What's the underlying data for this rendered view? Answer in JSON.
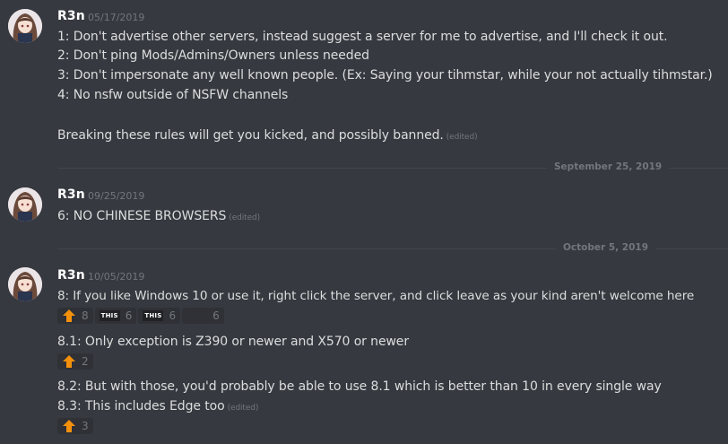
{
  "messages": [
    {
      "author": "R3n",
      "timestamp": "05/17/2019",
      "lines": [
        "1: Don't advertise other servers, instead suggest a server for me to advertise, and I'll check it out.",
        "2: Don't ping Mods/Admins/Owners unless needed",
        "3: Don't impersonate any well known people. (Ex: Saying your tihmstar, while your not actually tihmstar.)",
        "4: No nsfw outside of NSFW channels",
        "Breaking these rules will get you kicked, and possibly banned."
      ],
      "edited_label": "(edited)"
    },
    {
      "author": "R3n",
      "timestamp": "09/25/2019",
      "lines": [
        "6: NO CHINESE BROWSERS"
      ],
      "edited_label": "(edited)"
    },
    {
      "author": "R3n",
      "timestamp": "10/05/2019",
      "lines": [
        "8: If you like Windows 10 or use it, right click the server, and click leave as your kind aren't welcome here",
        "8.1: Only exception is Z390 or newer and X570 or newer",
        "8.2: But with those, you'd probably be able to use 8.1 which is better than 10 in every single way",
        "8.3: This includes Edge too"
      ],
      "edited_label": "(edited)"
    }
  ],
  "dividers": [
    "September 25, 2019",
    "October 5, 2019"
  ],
  "reactions": {
    "line8": [
      {
        "emoji": "arrow-up",
        "count": "8"
      },
      {
        "emoji": "this",
        "emoji_text": "THIS",
        "count": "6"
      },
      {
        "emoji": "this",
        "emoji_text": "THIS",
        "count": "6"
      },
      {
        "emoji": "blank",
        "count": "6"
      }
    ],
    "line81": [
      {
        "emoji": "arrow-up",
        "count": "2"
      }
    ],
    "line83": [
      {
        "emoji": "arrow-up",
        "count": "3"
      }
    ]
  },
  "colors": {
    "background": "#36393f",
    "text": "#dcddde",
    "username": "#ffffff",
    "muted": "#72767d",
    "reaction_bg": "#2f3136",
    "arrow": "#f4900c"
  }
}
